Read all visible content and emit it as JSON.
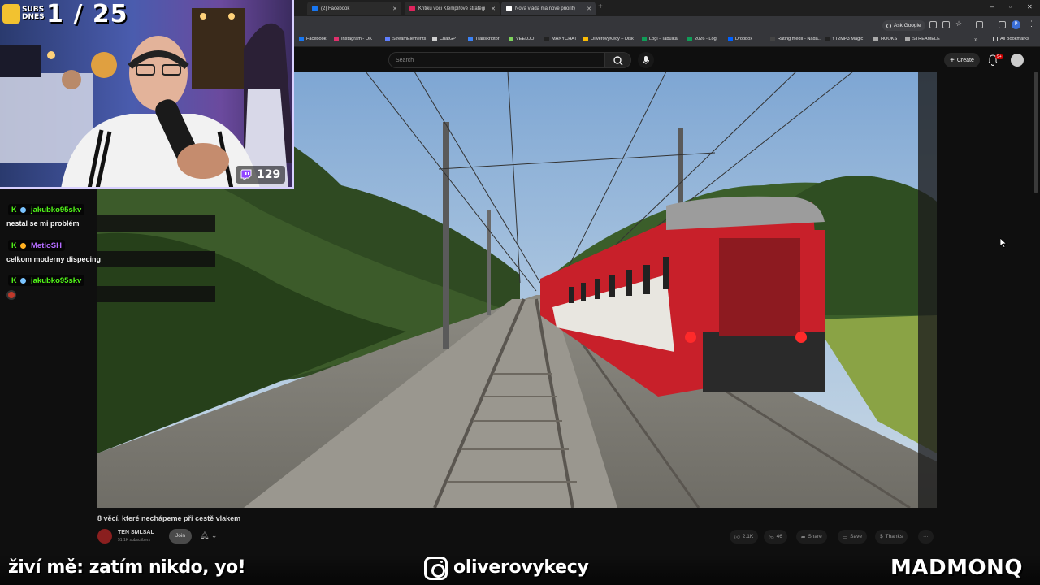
{
  "browser": {
    "tabs": [
      {
        "label": "(2) Facebook",
        "favicon_color": "#1877f2",
        "active": false
      },
      {
        "label": "Kritiku voči Klempířové stratégii",
        "favicon_color": "#e0245e",
        "active": false
      },
      {
        "label": "Nová vláda má nové priority",
        "favicon_color": "#ffffff",
        "active": true
      }
    ],
    "new_tab": "+",
    "window_controls": [
      "–",
      "▫",
      "✕"
    ],
    "ask_google": "Ask Google",
    "profile_initial": "P",
    "bookmarks": [
      {
        "label": "Facebook",
        "color": "#1877f2"
      },
      {
        "label": "Instagram - OK",
        "color": "#e1306c"
      },
      {
        "label": "StreamElements",
        "color": "#5f7fff"
      },
      {
        "label": "ChatGPT",
        "color": "#d0d0d0"
      },
      {
        "label": "Transkriptor",
        "color": "#3b82f6"
      },
      {
        "label": "VEEDJO",
        "color": "#7dd35c"
      },
      {
        "label": "MANYCHAT",
        "color": "#222222"
      },
      {
        "label": "OliverovyKecy – Disk",
        "color": "#fbbc04"
      },
      {
        "label": "Logi - Tabulka",
        "color": "#0f9d58"
      },
      {
        "label": "2026 - Logi",
        "color": "#0f9d58"
      },
      {
        "label": "Dropbox",
        "color": "#0061ff"
      },
      {
        "label": "Rating médií - Nadá...",
        "color": "#444444"
      },
      {
        "label": "YT2MP3 Magic",
        "color": "#222222"
      },
      {
        "label": "HOOKS",
        "color": "#aaaaaa"
      },
      {
        "label": "STREAMELE",
        "color": "#aaaaaa"
      }
    ],
    "bookmarks_more": "»",
    "all_bookmarks": "All Bookmarks"
  },
  "youtube": {
    "search_placeholder": "Search",
    "create_label": "Create",
    "notifications_badge": "9+",
    "video_title": "8 věcí, které nechápeme při cestě vlakem",
    "channel_name": "TEN SMLSAL",
    "channel_subs": "51.1K subscribers",
    "join_label": "Join",
    "likes": "2.1K",
    "dislikes": "46",
    "share_label": "Share",
    "save_label": "Save",
    "thanks_label": "Thanks",
    "more_label": "···"
  },
  "overlay": {
    "subs_label": "SUBS DNES",
    "subs_count": "1 / 25",
    "viewer_count": "129",
    "chat": [
      {
        "user": "jakubko95skv",
        "color": "#53fc18",
        "message": "nestal se mi problém"
      },
      {
        "user": "MetloSH",
        "color": "#a855f7",
        "message": "celkom moderny dispecing"
      },
      {
        "user": "jakubko95skv",
        "color": "#53fc18",
        "message": ""
      }
    ],
    "bottom_left": "živí mě: zatím nikdo, yo!",
    "instagram_handle": "oliverovykecy",
    "brand": "MADMONQ"
  },
  "colors": {
    "youtube_bg": "#0f0f0f",
    "chrome_bg": "#35363a",
    "kick_green": "#53fc18",
    "twitch_purple": "#9146ff",
    "train_red": "#c8202a"
  }
}
